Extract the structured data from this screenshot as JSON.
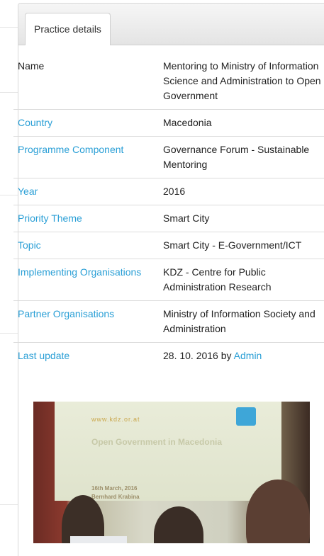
{
  "tab": {
    "label": "Practice details"
  },
  "details": [
    {
      "label": "Name",
      "label_style": "plain",
      "value": "Mentoring to Ministry of Information Science and Administration to Open Government"
    },
    {
      "label": "Country",
      "label_style": "link",
      "value": "Macedonia"
    },
    {
      "label": "Programme Component",
      "label_style": "link",
      "value": "Governance Forum - Sustainable Mentoring"
    },
    {
      "label": "Year",
      "label_style": "link",
      "value": "2016"
    },
    {
      "label": "Priority Theme",
      "label_style": "link",
      "value": "Smart City"
    },
    {
      "label": "Topic",
      "label_style": "link",
      "value": "Smart City - E-Government/ICT"
    },
    {
      "label": "Implementing Organisations",
      "label_style": "link",
      "value": "KDZ - Centre for Public Administration Research"
    },
    {
      "label": "Partner Organisations",
      "label_style": "link",
      "value": "Ministry of Information Society and Administration"
    },
    {
      "label": "Last update",
      "label_style": "link",
      "value_date": "28. 10. 2016 by",
      "value_author": "Admin"
    }
  ],
  "photo": {
    "slide_url": "www.kdz.or.at",
    "slide_title": "Open Government in Macedonia",
    "slide_date": "16th March, 2016",
    "slide_author": "Bernhard Krabina"
  },
  "colors": {
    "link": "#2a9fd6",
    "border": "#dcdcdc"
  }
}
